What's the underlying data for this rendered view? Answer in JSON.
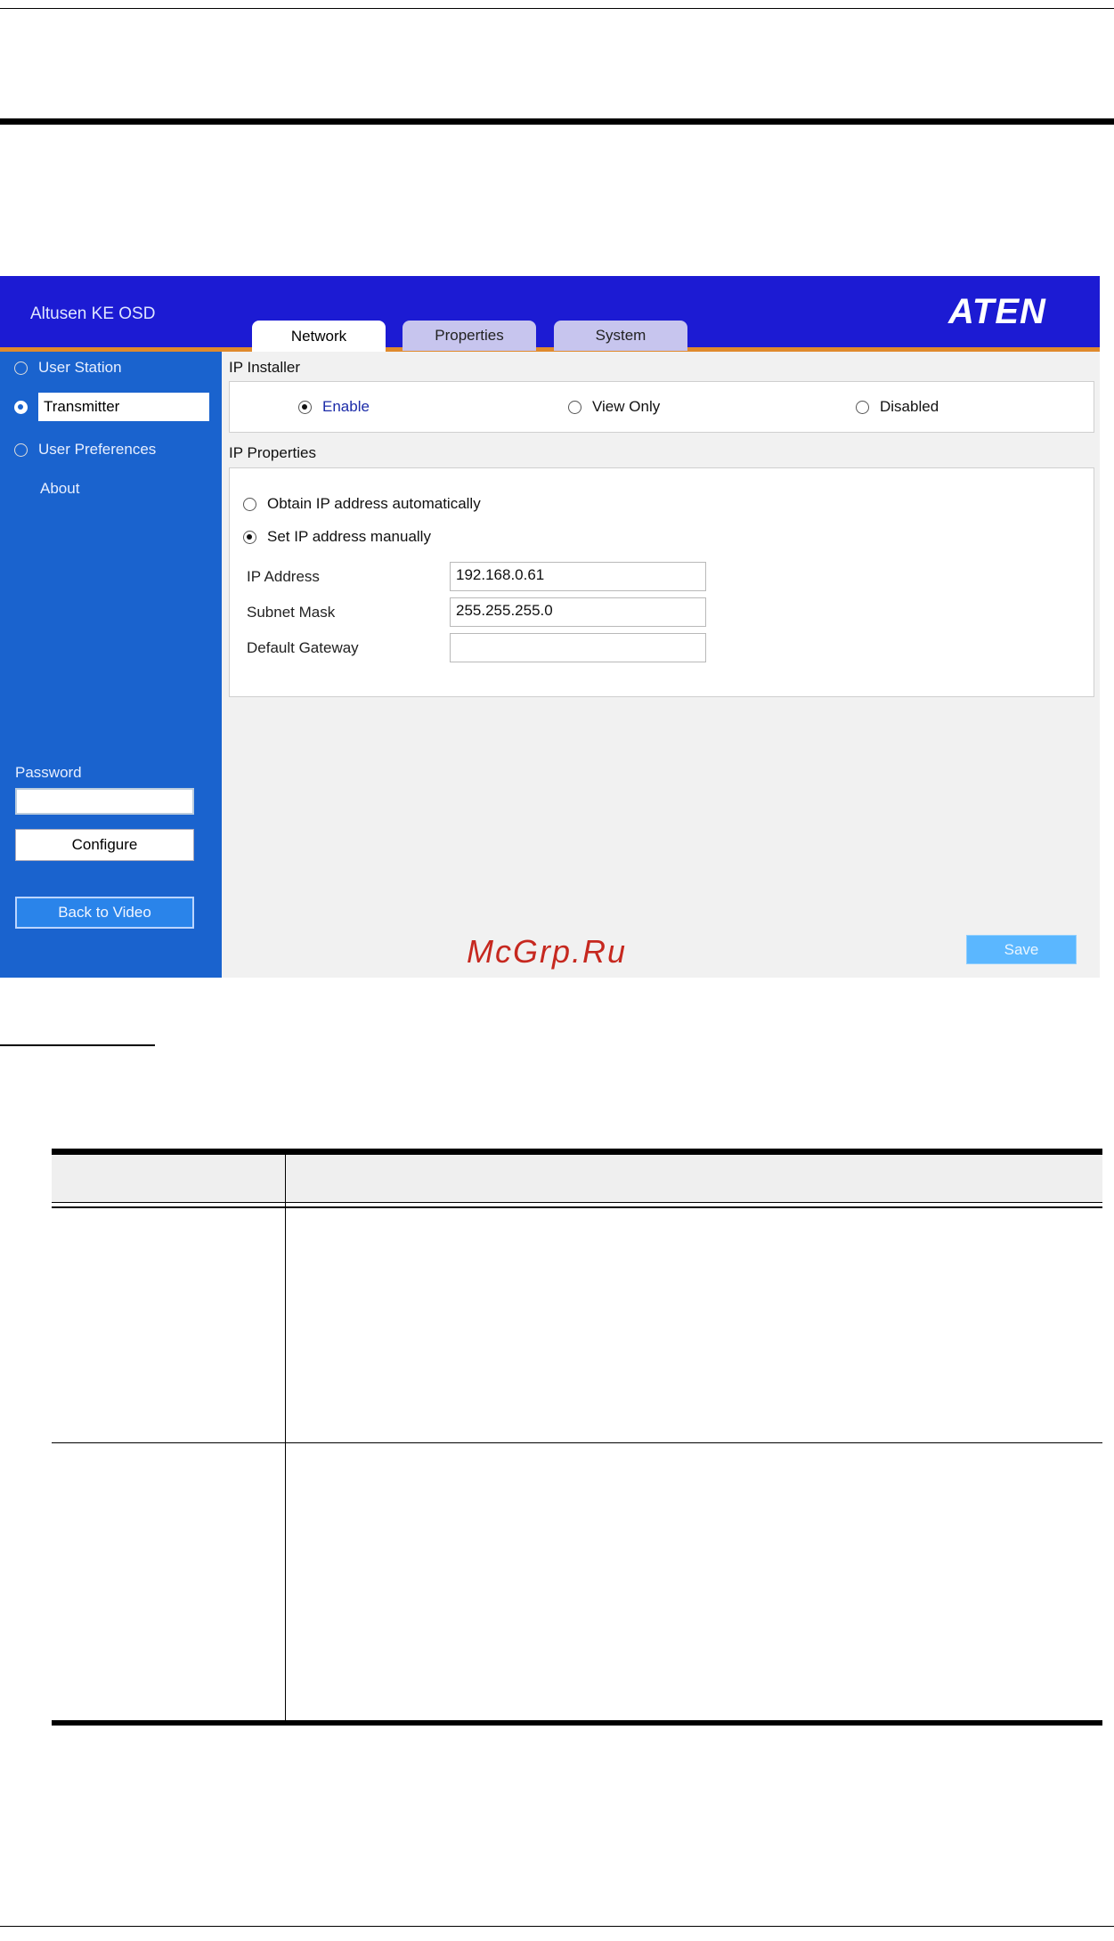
{
  "screenshot": {
    "app_title": "Altusen KE OSD",
    "logo": "ATEN",
    "tabs": [
      {
        "label": "Network",
        "active": true
      },
      {
        "label": "Properties",
        "active": false
      },
      {
        "label": "System",
        "active": false
      }
    ],
    "sidebar": {
      "items": [
        {
          "label": "User Station",
          "selected": false,
          "radio": true
        },
        {
          "label": "Transmitter",
          "selected": true,
          "radio": true
        },
        {
          "label": "User Preferences",
          "selected": false,
          "radio": true
        },
        {
          "label": "About",
          "selected": false,
          "radio": false
        }
      ],
      "password_label": "Password",
      "password_value": "",
      "configure_label": "Configure",
      "back_label": "Back to Video"
    },
    "ip_installer": {
      "title": "IP Installer",
      "options": [
        {
          "label": "Enable",
          "checked": true
        },
        {
          "label": "View Only",
          "checked": false
        },
        {
          "label": "Disabled",
          "checked": false
        }
      ]
    },
    "ip_properties": {
      "title": "IP Properties",
      "modes": [
        {
          "label": "Obtain IP address automatically",
          "checked": false
        },
        {
          "label": "Set IP address manually",
          "checked": true
        }
      ],
      "fields": [
        {
          "label": "IP Address",
          "value": "192.168.0.61"
        },
        {
          "label": "Subnet Mask",
          "value": "255.255.255.0"
        },
        {
          "label": "Default Gateway",
          "value": ""
        }
      ]
    },
    "save_label": "Save"
  },
  "watermark": "McGrp.Ru",
  "colors": {
    "banner": "#1c1bd3",
    "sidebar": "#1a63ce",
    "accent_line": "#e08a2c",
    "save": "#5bb7ff",
    "watermark": "#c6281f"
  }
}
